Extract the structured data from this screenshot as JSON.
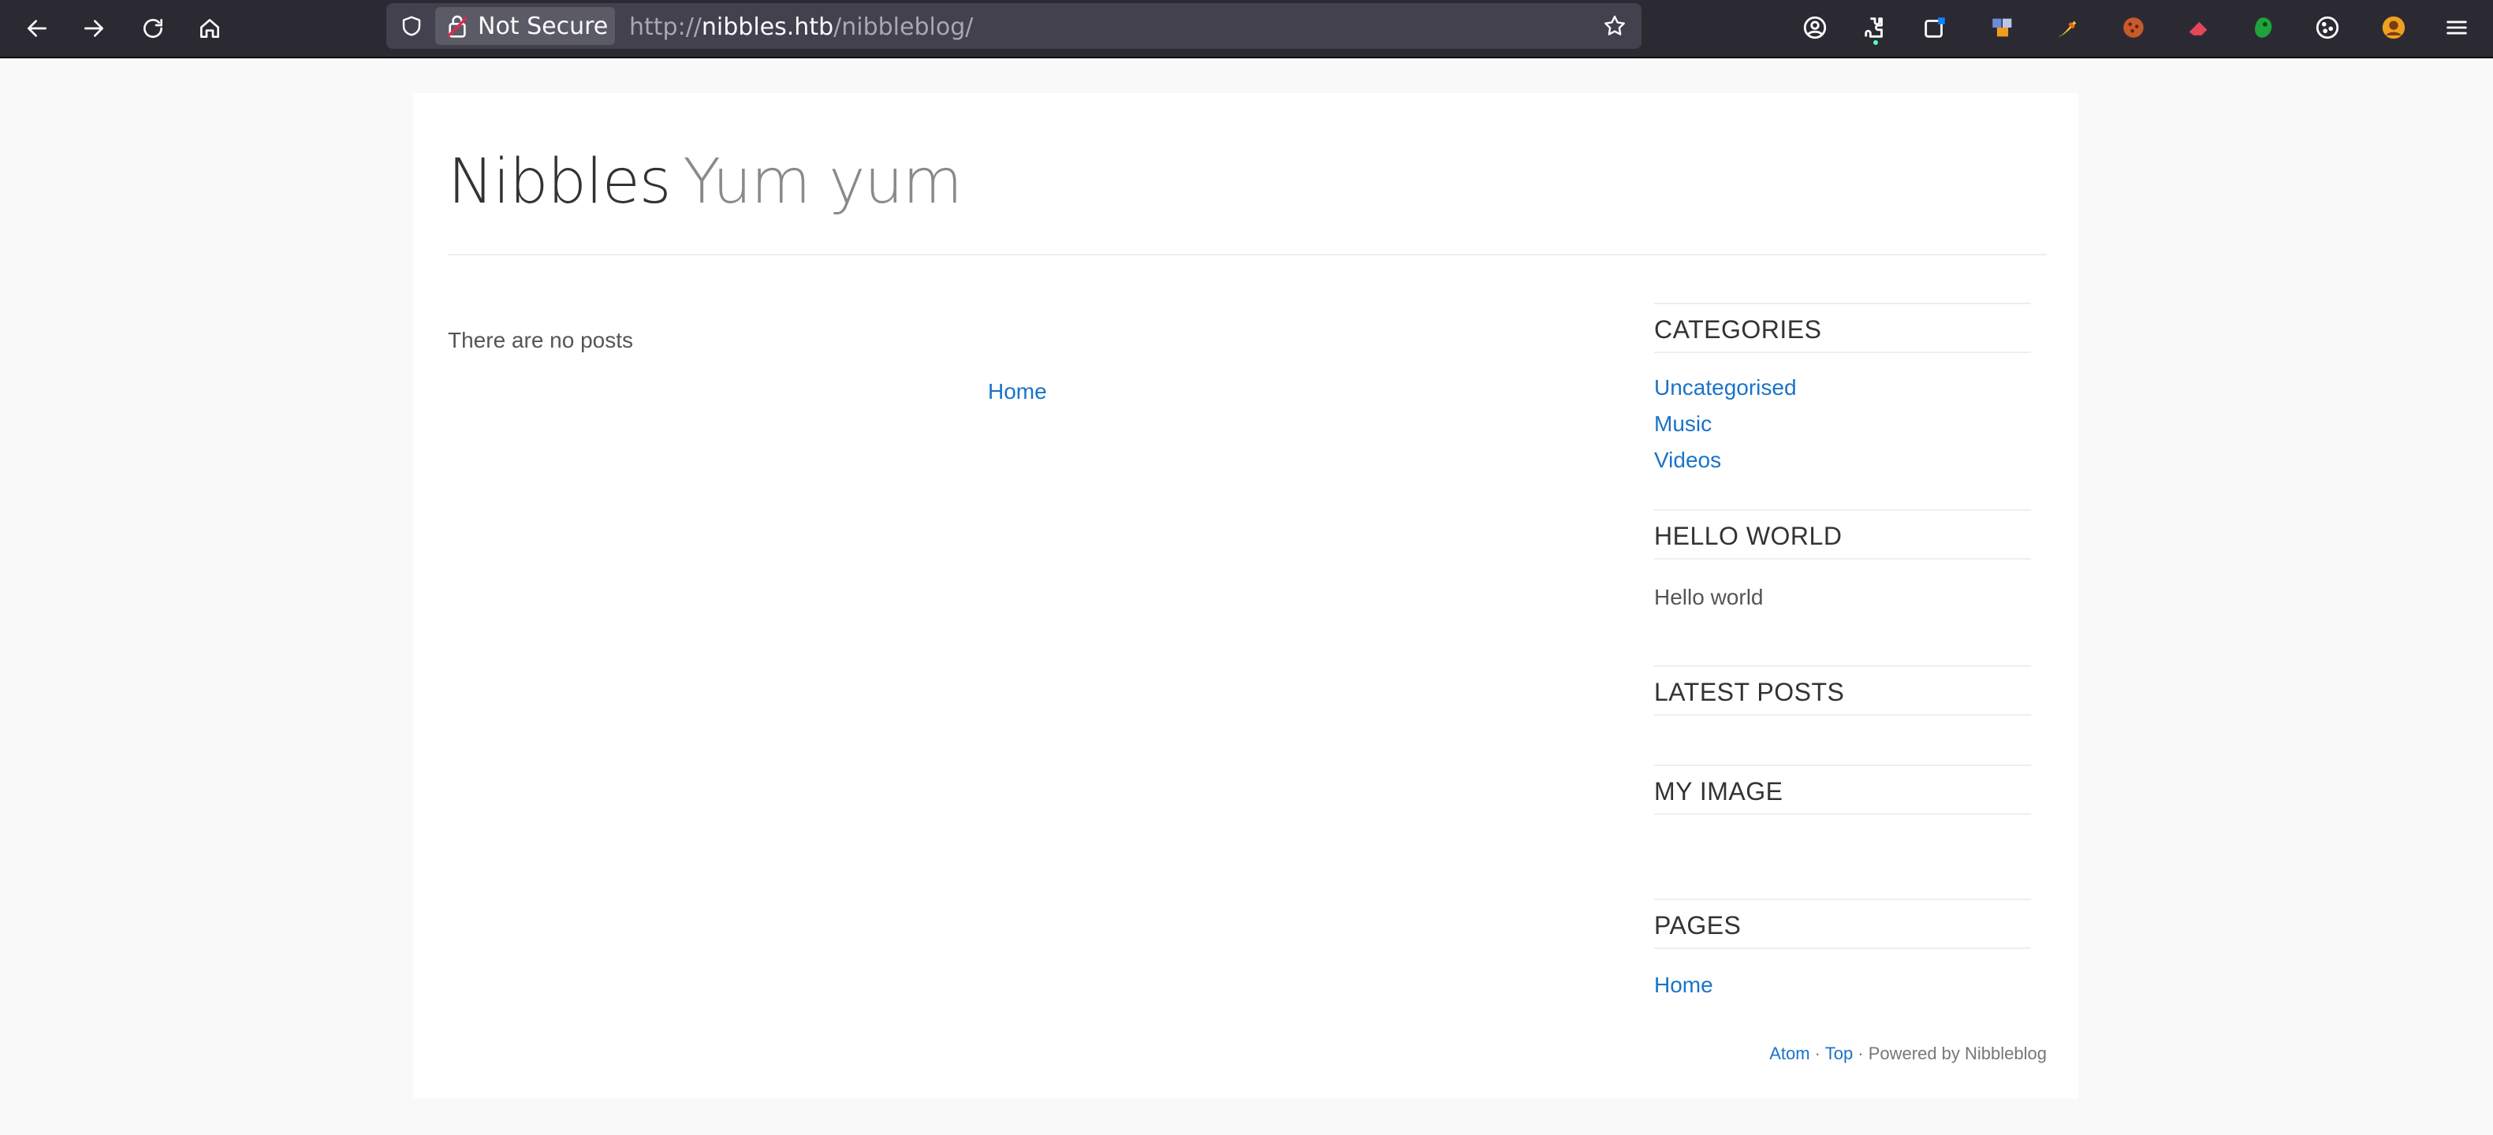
{
  "browser": {
    "security_label": "Not Secure",
    "url_scheme": "http://",
    "url_host": "nibbles.htb",
    "url_path": "/nibbleblog/",
    "nav_icons": [
      "back-arrow-icon",
      "forward-arrow-icon",
      "reload-icon",
      "home-icon"
    ],
    "toolbar_icons": [
      "account-icon",
      "extensions-icon",
      "new-tab-icon",
      "extension-puzzle-icon",
      "extension-brush-icon",
      "extension-cookie-icon",
      "extension-eraser-icon",
      "extension-green-icon",
      "cookie-icon",
      "extension-avatar-icon",
      "menu-icon"
    ]
  },
  "site": {
    "name": "Nibbles",
    "slogan": "Yum yum"
  },
  "main": {
    "empty_message": "There are no posts",
    "pager_home": "Home"
  },
  "sidebar": {
    "categories": {
      "title": "CATEGORIES",
      "items": [
        "Uncategorised",
        "Music",
        "Videos"
      ]
    },
    "hello_world": {
      "title": "HELLO WORLD",
      "text": "Hello world"
    },
    "latest_posts": {
      "title": "LATEST POSTS"
    },
    "my_image": {
      "title": "MY IMAGE"
    },
    "pages": {
      "title": "PAGES",
      "items": [
        "Home"
      ]
    }
  },
  "footer": {
    "atom": "Atom",
    "sep1": " · ",
    "top": "Top",
    "powered": " · Powered by Nibbleblog"
  },
  "colors": {
    "link": "#1a73c8",
    "toolbar_bg": "#2b2a33",
    "urlbar_bg": "#42414d"
  }
}
